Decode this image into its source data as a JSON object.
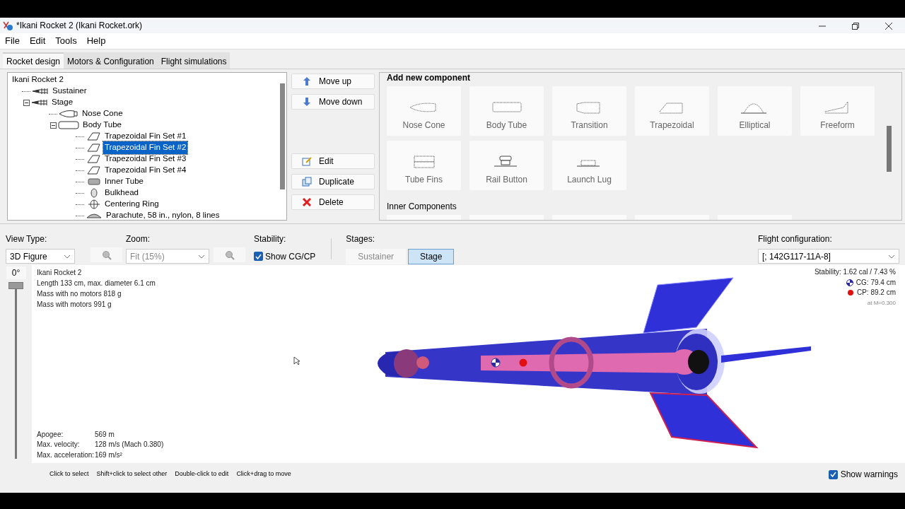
{
  "window": {
    "title": "*Ikani Rocket 2 (Ikani Rocket.ork)"
  },
  "menu": [
    "File",
    "Edit",
    "Tools",
    "Help"
  ],
  "tabs": [
    {
      "label": "Rocket design",
      "selected": true
    },
    {
      "label": "Motors & Configuration",
      "selected": false
    },
    {
      "label": "Flight simulations",
      "selected": false
    }
  ],
  "tree": {
    "label": "Ikani Rocket 2",
    "selected": false,
    "children": [
      {
        "label": "Sustainer",
        "kind": "stage",
        "selected": false
      },
      {
        "label": "Stage",
        "kind": "stage",
        "selected": false,
        "children": [
          {
            "label": "Nose Cone",
            "kind": "nosecone",
            "selected": false
          },
          {
            "label": "Body Tube",
            "kind": "bodytube",
            "selected": false,
            "children": [
              {
                "label": "Trapezoidal Fin Set #1",
                "kind": "fin",
                "selected": false
              },
              {
                "label": "Trapezoidal Fin Set #2",
                "kind": "fin",
                "selected": true
              },
              {
                "label": "Trapezoidal Fin Set #3",
                "kind": "fin",
                "selected": false
              },
              {
                "label": "Trapezoidal Fin Set #4",
                "kind": "fin",
                "selected": false
              },
              {
                "label": "Inner Tube",
                "kind": "innertube",
                "selected": false
              },
              {
                "label": "Bulkhead",
                "kind": "bulkhead",
                "selected": false
              },
              {
                "label": "Centering Ring",
                "kind": "ring",
                "selected": false
              },
              {
                "label": "Parachute, 58 in., nylon, 8 lines",
                "kind": "parachute",
                "selected": false
              }
            ]
          }
        ]
      }
    ]
  },
  "actions": [
    {
      "label": "Move up",
      "kind": "up"
    },
    {
      "label": "Move down",
      "kind": "down"
    },
    {
      "label": "Edit",
      "kind": "edit"
    },
    {
      "label": "Duplicate",
      "kind": "duplicate"
    },
    {
      "label": "Delete",
      "kind": "delete"
    }
  ],
  "add_component": {
    "title": "Add new component",
    "components": [
      {
        "label": "Nose Cone",
        "kind": "nosecone"
      },
      {
        "label": "Body Tube",
        "kind": "bodytube"
      },
      {
        "label": "Transition",
        "kind": "transition"
      },
      {
        "label": "Trapezoidal",
        "kind": "trapezoidal"
      },
      {
        "label": "Elliptical",
        "kind": "elliptical"
      },
      {
        "label": "Freeform",
        "kind": "freeform"
      },
      {
        "label": "Tube Fins",
        "kind": "tubefins"
      },
      {
        "label": "Rail Button",
        "kind": "railbutton"
      },
      {
        "label": "Launch Lug",
        "kind": "launchlug"
      }
    ],
    "inner_title": "Inner Components"
  },
  "view_type": {
    "label": "View Type:",
    "value": "3D Figure"
  },
  "zoom": {
    "label": "Zoom:",
    "value": "Fit (15%)"
  },
  "stability": {
    "label": "Stability:",
    "option": {
      "label": "Show CG/CP",
      "checked": true
    }
  },
  "stages": {
    "label": "Stages:",
    "buttons": [
      {
        "label": "Sustainer",
        "selected": false
      },
      {
        "label": "Stage",
        "selected": true
      }
    ]
  },
  "flight_configuration": {
    "label": "Flight configuration:",
    "value": "[; 142G117-11A-8]"
  },
  "rotation": {
    "label": "0°",
    "level": 0
  },
  "info": [
    "Ikani Rocket 2",
    "Length 133 cm, max. diameter 6.1 cm",
    "Mass with no motors 818 g",
    "Mass with motors 991 g"
  ],
  "stability_info": {
    "summary": "Stability: 1.62 cal / 7.43 %",
    "cg": "CG: 79.4 cm",
    "cp": "CP: 89.2 cm",
    "mach": "at M=0.300"
  },
  "flight_data": [
    {
      "label": "Apogee:",
      "value": "569 m"
    },
    {
      "label": "Max. velocity:",
      "value": "128 m/s  (Mach 0.380)"
    },
    {
      "label": "Max. acceleration:",
      "value": "169 m/s²"
    }
  ],
  "hints": [
    "Click to select",
    "Shift+click to select other",
    "Double-click to edit",
    "Click+drag to move"
  ],
  "show_warnings": {
    "label": "Show warnings",
    "checked": true
  }
}
